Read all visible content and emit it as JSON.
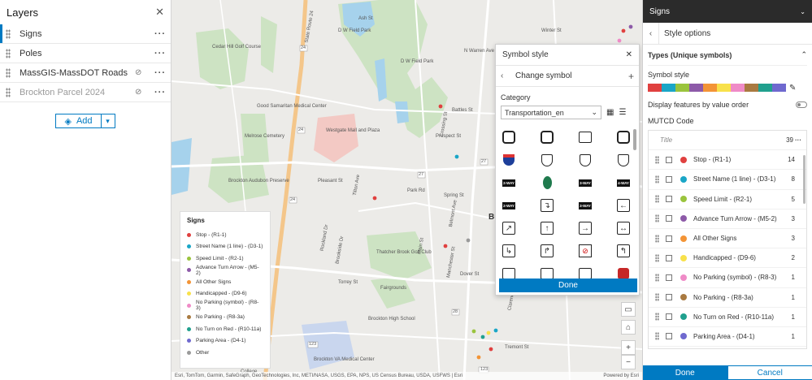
{
  "layers_panel": {
    "title": "Layers",
    "items": [
      {
        "label": "Signs",
        "dim": false,
        "hidden": false
      },
      {
        "label": "Poles",
        "dim": false,
        "hidden": false
      },
      {
        "label": "MassGIS-MassDOT Roads",
        "dim": false,
        "hidden": true
      },
      {
        "label": "Brockton Parcel 2024",
        "dim": true,
        "hidden": true
      }
    ],
    "add_label": "Add"
  },
  "map": {
    "labels": [
      "State Route 24",
      "D W Field Park",
      "D W Field Park",
      "Cedar Hill Golf Course",
      "Good Samaritan Medical Center",
      "Westgate Mall and Plaza",
      "Melrose Cemetery",
      "Brockton Audubon Preserve",
      "Pleasant St",
      "Park Rd",
      "Spring St",
      "Battles St",
      "Prospect St",
      "Thatcher Brook Golf Club",
      "Torrey St",
      "Fairgrounds",
      "Brockton High School",
      "Brockton VA Medical Center",
      "Dover St",
      "Florence St",
      "N Warren Ave",
      "Crossing St",
      "Belmont Ave",
      "Main St",
      "Ash St",
      "Winter St",
      "Rockland Dr",
      "Brookside Dr",
      "Tilton Ave",
      "Manchester St",
      "Union St",
      "Clarendon Ave",
      "Kimball St",
      "Wilson St",
      "Tremont St",
      "Bro",
      "College"
    ],
    "attribution": "Esri, TomTom, Garmin, SafeGraph, GeoTechnologies, Inc, METI/NASA, USGS, EPA, NPS, US Census Bureau, USDA, USFWS | Esri",
    "powered_by": "Powered by Esri"
  },
  "legend": {
    "title": "Signs",
    "items": [
      {
        "label": "Stop - (R1-1)",
        "color": "#e0403f"
      },
      {
        "label": "Street Name (1 line) - (D3-1)",
        "color": "#1aa6c7"
      },
      {
        "label": "Speed Limit - (R2-1)",
        "color": "#9ac43d"
      },
      {
        "label": "Advance Turn Arrow - (M5-2)",
        "color": "#8d5aa8"
      },
      {
        "label": "All Other Signs",
        "color": "#f39436"
      },
      {
        "label": "Handicapped - (D9-6)",
        "color": "#f8e14b"
      },
      {
        "label": "No Parking (symbol) - (R8-3)",
        "color": "#ef8bc7"
      },
      {
        "label": "No Parking - (R8-3a)",
        "color": "#a97a41"
      },
      {
        "label": "No Turn on Red - (R10-11a)",
        "color": "#20a08e"
      },
      {
        "label": "Parking Area - (D4-1)",
        "color": "#6f69cf"
      },
      {
        "label": "Other",
        "color": "#9a9a9a"
      }
    ]
  },
  "map_badges": [
    "24",
    "24",
    "24",
    "27",
    "27",
    "28",
    "123",
    "123",
    "24"
  ],
  "symbol_popup": {
    "title": "Symbol style",
    "subtitle": "Change symbol",
    "category_label": "Category",
    "category_value": "Transportation_en",
    "done_label": "Done",
    "sign_texts": [
      "2-WAY",
      "3-WAY",
      "4-WAY",
      "2-WAY",
      "3-WAY",
      "4-WAY"
    ]
  },
  "right_panel": {
    "header": "Signs",
    "subheader": "Style options",
    "section_title": "Types (Unique symbols)",
    "symbol_style_label": "Symbol style",
    "ramp_colors": [
      "#e0403f",
      "#1aa6c7",
      "#9ac43d",
      "#8d5aa8",
      "#f39436",
      "#f8e14b",
      "#ef8bc7",
      "#a97a41",
      "#20a08e",
      "#6f69cf"
    ],
    "toggle_label": "Display features by value order",
    "field_label": "MUTCD Code",
    "title_row": {
      "label": "Title",
      "count": "39"
    },
    "rows": [
      {
        "label": "Stop - (R1-1)",
        "count": "14",
        "color": "#e0403f"
      },
      {
        "label": "Street Name (1 line) - (D3-1)",
        "count": "8",
        "color": "#1aa6c7"
      },
      {
        "label": "Speed Limit - (R2-1)",
        "count": "5",
        "color": "#9ac43d"
      },
      {
        "label": "Advance Turn Arrow - (M5-2)",
        "count": "3",
        "color": "#8d5aa8"
      },
      {
        "label": "All Other Signs",
        "count": "3",
        "color": "#f39436"
      },
      {
        "label": "Handicapped - (D9-6)",
        "count": "2",
        "color": "#f8e14b"
      },
      {
        "label": "No Parking (symbol) - (R8-3)",
        "count": "1",
        "color": "#ef8bc7"
      },
      {
        "label": "No Parking - (R8-3a)",
        "count": "1",
        "color": "#a97a41"
      },
      {
        "label": "No Turn on Red - (R10-11a)",
        "count": "1",
        "color": "#20a08e"
      },
      {
        "label": "Parking Area - (D4-1)",
        "count": "1",
        "color": "#6f69cf"
      }
    ],
    "done_label": "Done",
    "cancel_label": "Cancel"
  },
  "map_controls": [
    "monitor-icon",
    "home-icon",
    "zoom-in-icon",
    "zoom-out-icon"
  ],
  "icons": {
    "close": "close-icon",
    "grip": "drag-handle-icon",
    "more": "more-icon",
    "eye-off": "eye-off-icon",
    "back": "chevron-left-icon",
    "plus": "plus-icon",
    "pencil": "pencil-icon",
    "grid": "grid-view-icon",
    "list": "list-view-icon"
  }
}
